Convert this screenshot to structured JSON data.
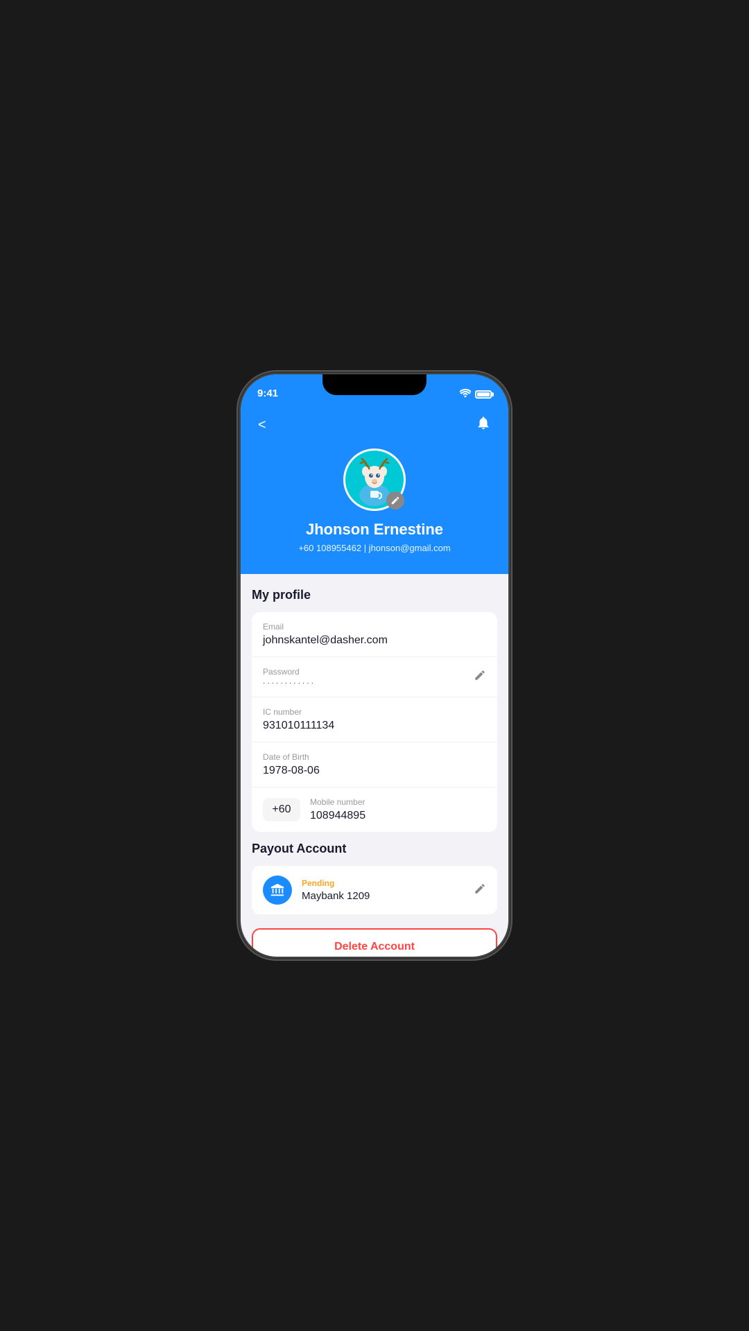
{
  "statusBar": {
    "time": "9:41"
  },
  "header": {
    "backLabel": "<",
    "userName": "Jhonson Ernestine",
    "userPhone": "+60 108955462",
    "userEmail": "jhonson@gmail.com",
    "userContact": "+60 108955462 | jhonson@gmail.com"
  },
  "myProfile": {
    "sectionTitle": "My profile",
    "emailLabel": "Email",
    "emailValue": "johnskantel@dasher.com",
    "passwordLabel": "Password",
    "passwordValue": "············",
    "icLabel": "IC number",
    "icValue": "931010111134",
    "dobLabel": "Date of Birth",
    "dobValue": "1978-08-06",
    "countryCode": "+60",
    "mobileLabel": "Mobile number",
    "mobileValue": "108944895"
  },
  "payoutAccount": {
    "sectionTitle": "Payout Account",
    "status": "Pending",
    "bankName": "Maybank 1209"
  },
  "deleteButton": {
    "label": "Delete Account"
  }
}
